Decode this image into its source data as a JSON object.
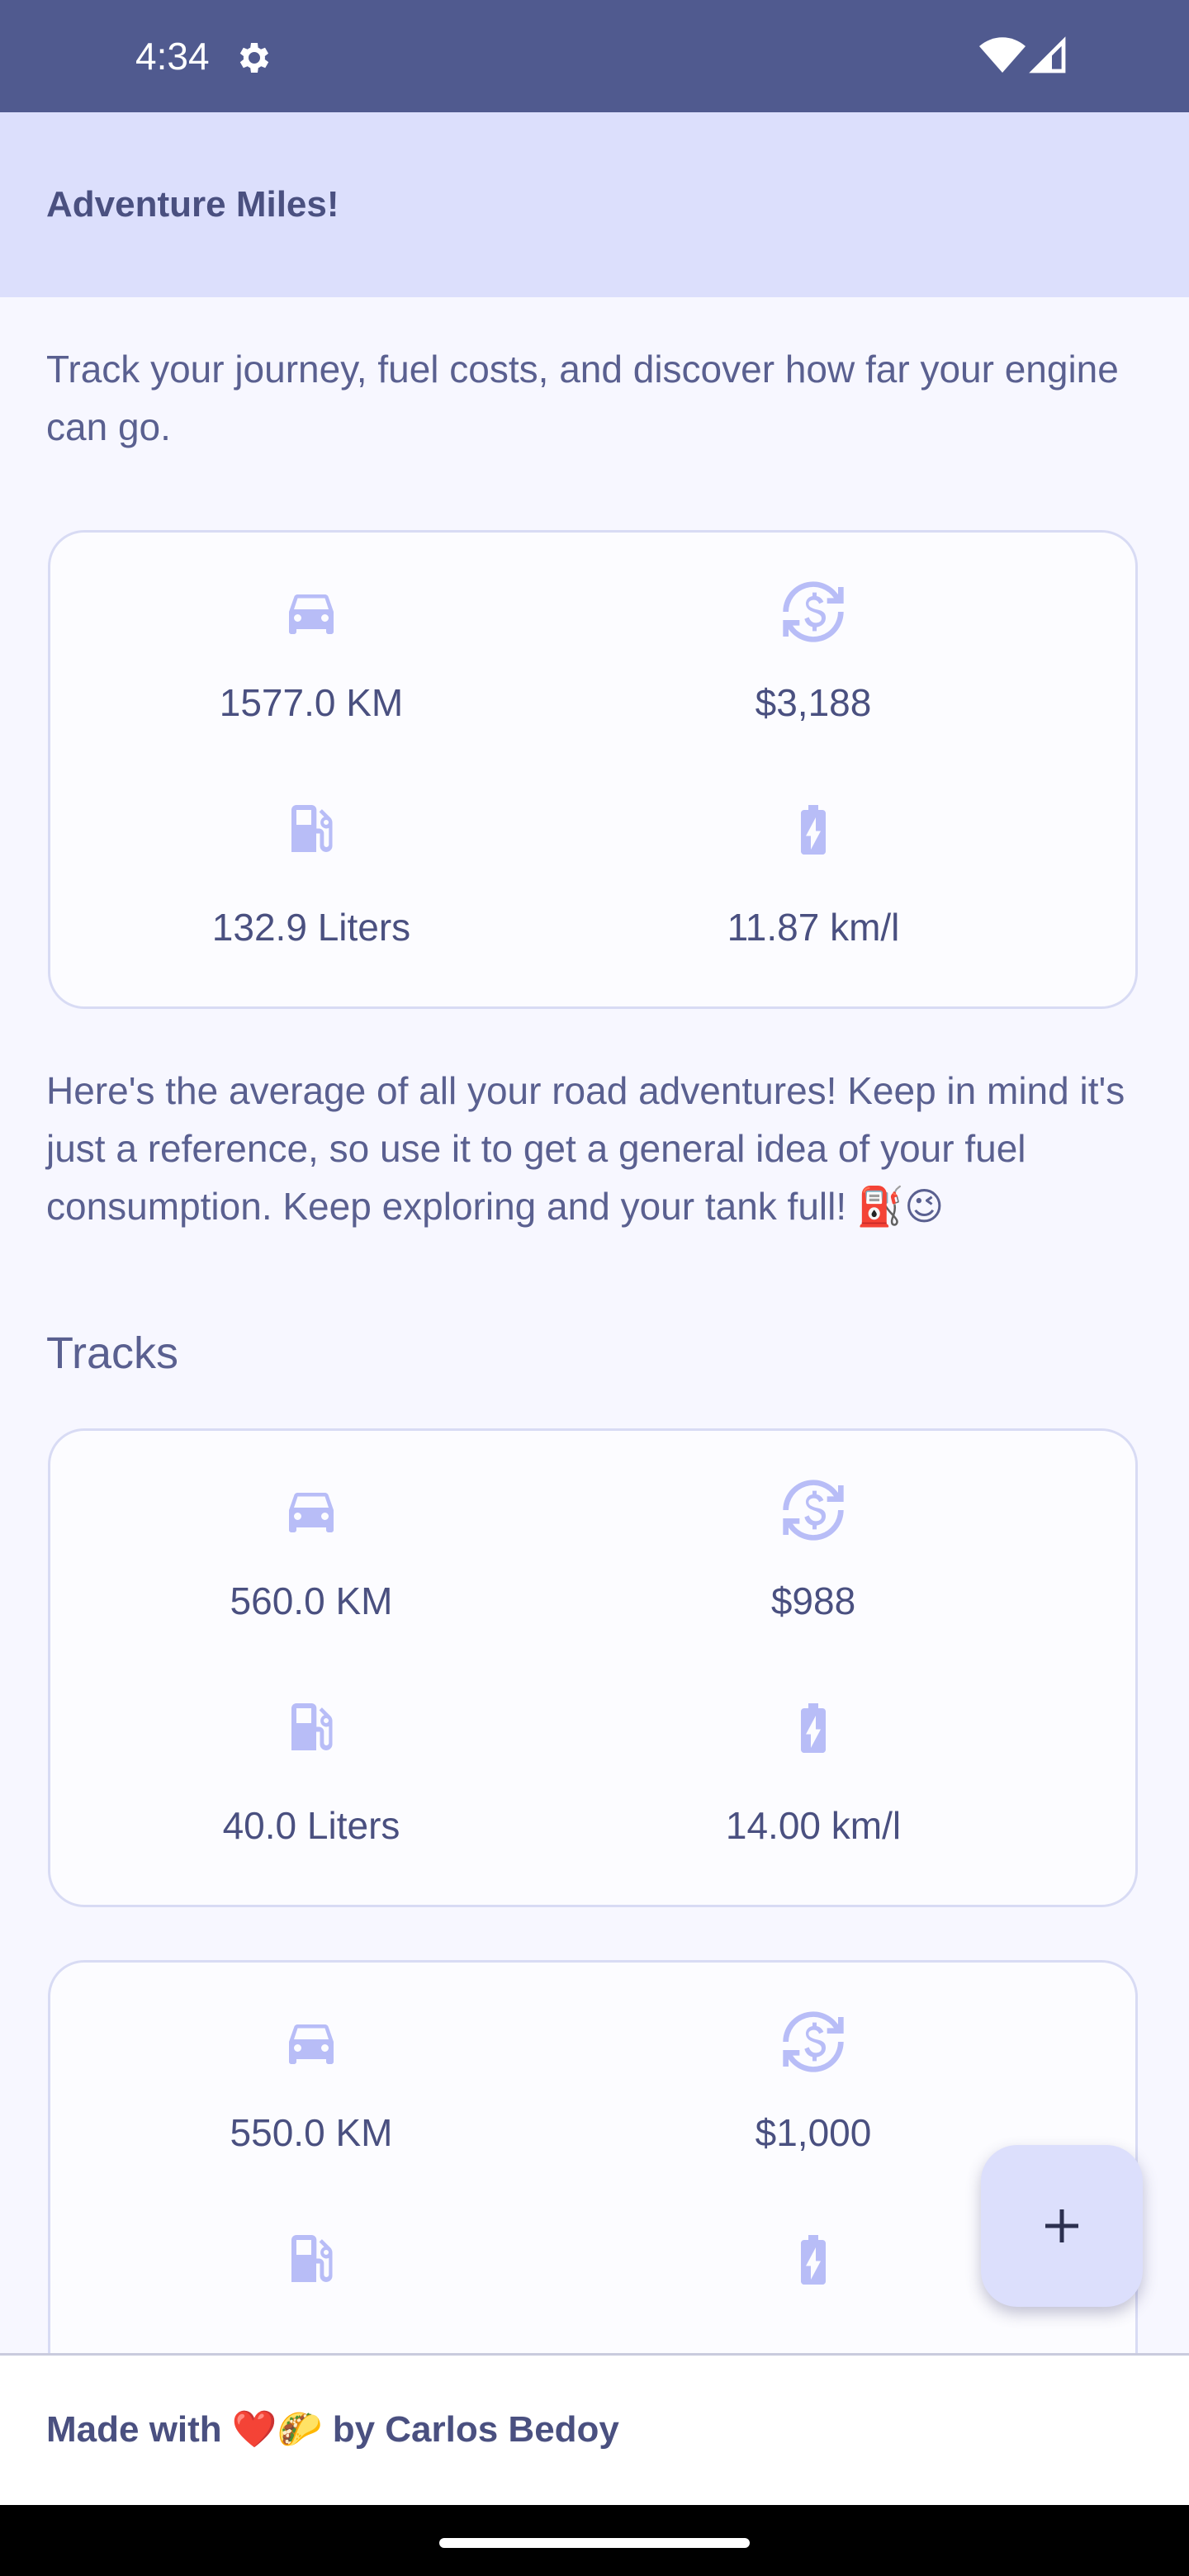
{
  "status_bar": {
    "time": "4:34",
    "settings_icon": "gear-icon",
    "wifi_icon": "wifi-icon",
    "signal_icon": "cell-signal-icon"
  },
  "app": {
    "title": "Adventure Miles!"
  },
  "intro": "Track your journey, fuel costs, and discover how far your engine can go.",
  "summary": {
    "distance": "1577.0 KM",
    "cost": "$3,188",
    "fuel": "132.9 Liters",
    "efficiency": "11.87 km/l"
  },
  "paragraph": "Here's the average of all your road adventures! Keep in mind it's just a reference, so use it to get a general idea of your fuel consumption. Keep exploring and your tank full! ⛽😉",
  "tracks_title": "Tracks",
  "tracks": [
    {
      "distance": "560.0 KM",
      "cost": "$988",
      "fuel": "40.0 Liters",
      "efficiency": "14.00 km/l"
    },
    {
      "distance": "550.0 KM",
      "cost": "$1,000",
      "fuel": "",
      "efficiency": ""
    }
  ],
  "icons": {
    "distance": "car-icon",
    "cost": "currency-exchange-icon",
    "fuel": "fuel-pump-icon",
    "efficiency": "battery-charging-icon"
  },
  "fab": {
    "icon": "plus-icon"
  },
  "footer": {
    "text": "Made with ❤️🌮 by Carlos Bedoy"
  },
  "colors": {
    "status_bar": "#505a8f",
    "app_bar": "#dcdffc",
    "text": "#4a5080",
    "icon": "#b8bdf7",
    "card_border": "#d8dbf4"
  }
}
